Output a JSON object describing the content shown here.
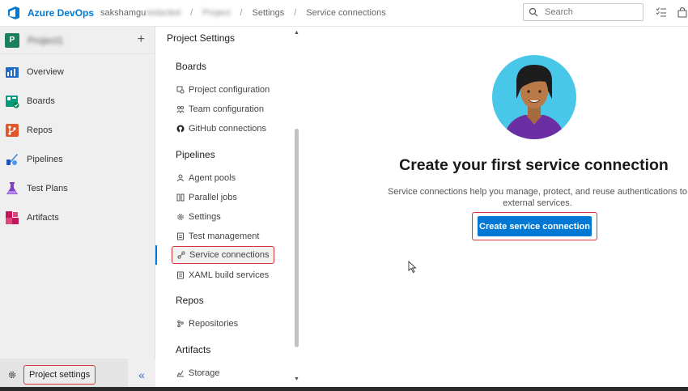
{
  "header": {
    "brand": "Azure DevOps",
    "org": "sakshamgu",
    "project": "Project",
    "crumb_settings": "Settings",
    "crumb_page": "Service connections",
    "search_placeholder": "Search"
  },
  "leftnav": {
    "project_initial": "P",
    "project_name": "Project1",
    "items": [
      {
        "label": "Overview",
        "icon": "overview-icon"
      },
      {
        "label": "Boards",
        "icon": "boards-icon"
      },
      {
        "label": "Repos",
        "icon": "repos-icon"
      },
      {
        "label": "Pipelines",
        "icon": "pipelines-icon"
      },
      {
        "label": "Test Plans",
        "icon": "test-plans-icon"
      },
      {
        "label": "Artifacts",
        "icon": "artifacts-icon"
      }
    ],
    "project_settings": "Project settings",
    "collapse_glyph": "«"
  },
  "settings": {
    "title": "Project Settings",
    "sections": {
      "boards": "Boards",
      "pipelines": "Pipelines",
      "repos": "Repos",
      "artifacts": "Artifacts"
    },
    "items": {
      "project_configuration": "Project configuration",
      "team_configuration": "Team configuration",
      "github_connections": "GitHub connections",
      "agent_pools": "Agent pools",
      "parallel_jobs": "Parallel jobs",
      "settings": "Settings",
      "test_management": "Test management",
      "service_connections": "Service connections",
      "xaml_build_services": "XAML build services",
      "repositories": "Repositories",
      "storage": "Storage"
    }
  },
  "main": {
    "title": "Create your first service connection",
    "description": "Service connections help you manage, protect, and reuse authentications to external services.",
    "cta": "Create service connection"
  },
  "colors": {
    "accent": "#0078d4",
    "highlight": "#d9363e"
  }
}
